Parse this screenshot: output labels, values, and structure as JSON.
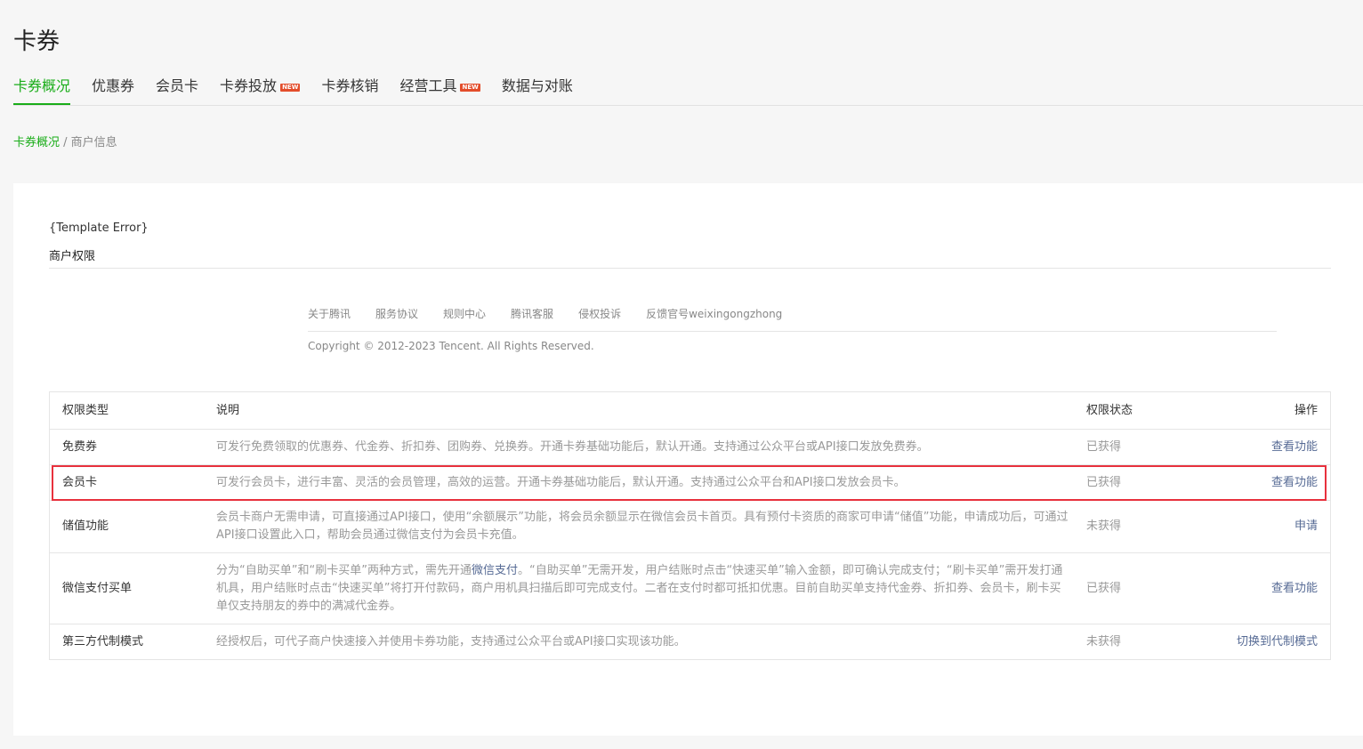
{
  "page": {
    "title": "卡券"
  },
  "tabs": [
    {
      "label": "卡券概况",
      "active": true,
      "new": false
    },
    {
      "label": "优惠券",
      "active": false,
      "new": false
    },
    {
      "label": "会员卡",
      "active": false,
      "new": false
    },
    {
      "label": "卡券投放",
      "active": false,
      "new": true
    },
    {
      "label": "卡券核销",
      "active": false,
      "new": false
    },
    {
      "label": "经营工具",
      "active": false,
      "new": true
    },
    {
      "label": "数据与对账",
      "active": false,
      "new": false
    }
  ],
  "badge": {
    "new_label": "NEW"
  },
  "breadcrumb": {
    "root": "卡券概况",
    "separator": " / ",
    "current": "商户信息"
  },
  "panel": {
    "template_error": "{Template Error}",
    "permissions_title": "商户权限"
  },
  "footer": {
    "links": [
      "关于腾讯",
      "服务协议",
      "规则中心",
      "腾讯客服",
      "侵权投诉",
      "反馈官号weixingongzhong"
    ],
    "copyright": "Copyright © 2012-2023 Tencent. All Rights Reserved."
  },
  "table": {
    "headers": {
      "type": "权限类型",
      "desc": "说明",
      "status": "权限状态",
      "op": "操作"
    },
    "rows": [
      {
        "type": "免费券",
        "desc": "可发行免费领取的优惠券、代金券、折扣券、团购券、兑换券。开通卡券基础功能后，默认开通。支持通过公众平台或API接口发放免费券。",
        "status": "已获得",
        "op": "查看功能"
      },
      {
        "type": "会员卡",
        "desc": "可发行会员卡，进行丰富、灵活的会员管理，高效的运营。开通卡券基础功能后，默认开通。支持通过公众平台和API接口发放会员卡。",
        "status": "已获得",
        "op": "查看功能"
      },
      {
        "type": "储值功能",
        "desc": "会员卡商户无需申请，可直接通过API接口，使用“余额展示”功能，将会员余额显示在微信会员卡首页。具有预付卡资质的商家可申请“储值”功能，申请成功后，可通过API接口设置此入口，帮助会员通过微信支付为会员卡充值。",
        "status": "未获得",
        "op": "申请"
      },
      {
        "type": "微信支付买单",
        "desc_before": "分为“自助买单”和“刷卡买单”两种方式，需先开通",
        "desc_link": "微信支付",
        "desc_after": "。“自助买单”无需开发，用户结账时点击“快速买单”输入金额，即可确认完成支付；“刷卡买单”需开发打通机具，用户结账时点击“快速买单”将打开付款码，商户用机具扫描后即可完成支付。二者在支付时都可抵扣优惠。目前自助买单支持代金券、折扣券、会员卡，刷卡买单仅支持朋友的券中的满减代金券。",
        "status": "已获得",
        "op": "查看功能"
      },
      {
        "type": "第三方代制模式",
        "desc": "经授权后，可代子商户快速接入并使用卡券功能，支持通过公众平台或API接口实现该功能。",
        "status": "未获得",
        "op": "切换到代制模式"
      }
    ]
  },
  "colors": {
    "accent": "#1aad19",
    "link": "#576b95",
    "highlight": "#e8313d",
    "new_badge": "#e34d2b"
  }
}
